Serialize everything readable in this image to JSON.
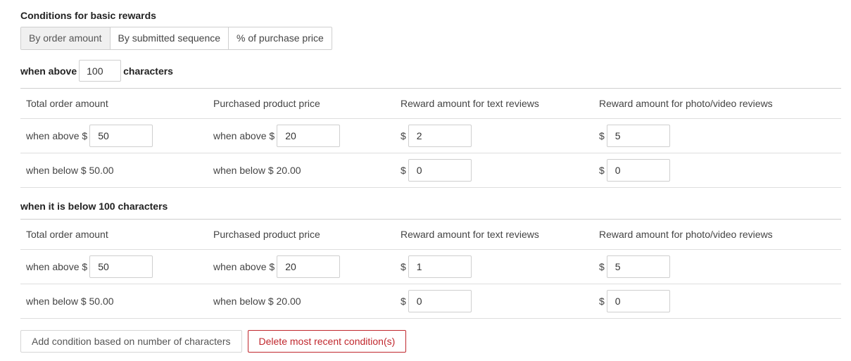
{
  "title": "Conditions for basic rewards",
  "tabs": [
    {
      "label": "By order amount",
      "active": true
    },
    {
      "label": "By submitted sequence",
      "active": false
    },
    {
      "label": "% of purchase price",
      "active": false
    }
  ],
  "chars_row": {
    "prefix": "when above",
    "value": "100",
    "suffix": "characters"
  },
  "headers": [
    "Total order amount",
    "Purchased product price",
    "Reward amount for text reviews",
    "Reward amount for photo/video reviews"
  ],
  "above_block": {
    "rows": [
      {
        "order_label": "when above $",
        "order_value": "50",
        "price_label": "when above $",
        "price_value": "20",
        "text_prefix": "$",
        "text_value": "2",
        "photo_prefix": "$",
        "photo_value": "5"
      },
      {
        "order_label": "when below $ 50.00",
        "price_label": "when below $ 20.00",
        "text_prefix": "$",
        "text_value": "0",
        "photo_prefix": "$",
        "photo_value": "0"
      }
    ]
  },
  "below_title": "when it is below 100 characters",
  "below_block": {
    "rows": [
      {
        "order_label": "when above $",
        "order_value": "50",
        "price_label": "when above $",
        "price_value": "20",
        "text_prefix": "$",
        "text_value": "1",
        "photo_prefix": "$",
        "photo_value": "5"
      },
      {
        "order_label": "when below $ 50.00",
        "price_label": "when below $ 20.00",
        "text_prefix": "$",
        "text_value": "0",
        "photo_prefix": "$",
        "photo_value": "0"
      }
    ]
  },
  "buttons": {
    "add": "Add condition based on number of characters",
    "delete": "Delete most recent condition(s)"
  },
  "colors": {
    "danger": "#c0272d",
    "active_tab_bg": "#f0f0f0"
  }
}
